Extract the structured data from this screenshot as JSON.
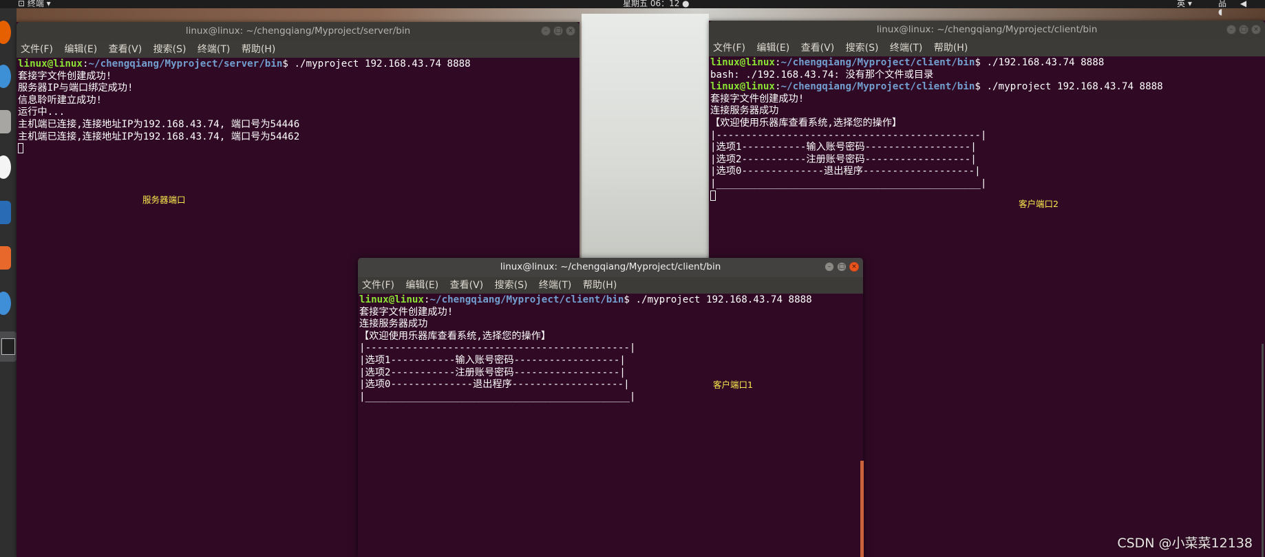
{
  "topbar": {
    "app_menu": "⊡ 终端 ▾",
    "clock": "星期五 06：12 ●",
    "ime": "英 ▾",
    "tray": "品 ◀ ◖"
  },
  "windows": {
    "server": {
      "title": "linux@linux: ~/chengqiang/Myproject/server/bin",
      "menu": [
        "文件(F)",
        "编辑(E)",
        "查看(V)",
        "搜索(S)",
        "终端(T)",
        "帮助(H)"
      ],
      "prompt": {
        "user": "linux@linux",
        "path": "~/chengqiang/Myproject/server/bin",
        "command": "$ ./myproject 192.168.43.74 8888"
      },
      "output": [
        "套接字文件创建成功!",
        "服务器IP与端口绑定成功!",
        "信息聆听建立成功!",
        "运行中...",
        "主机端已连接,连接地址IP为192.168.43.74, 端口号为54446",
        "主机端已连接,连接地址IP为192.168.43.74, 端口号为54462"
      ],
      "note": "服务器端口"
    },
    "client2": {
      "title": "linux@linux: ~/chengqiang/Myproject/client/bin",
      "menu": [
        "文件(F)",
        "编辑(E)",
        "查看(V)",
        "搜索(S)",
        "终端(T)",
        "帮助(H)"
      ],
      "prompt1": {
        "user": "linux@linux",
        "path": "~/chengqiang/Myproject/client/bin",
        "command": "$ ./192.168.43.74 8888"
      },
      "error": "bash: ./192.168.43.74: 没有那个文件或目录",
      "prompt2": {
        "user": "linux@linux",
        "path": "~/chengqiang/Myproject/client/bin",
        "command": "$ ./myproject 192.168.43.74 8888"
      },
      "output": [
        "套接字文件创建成功!",
        "连接服务器成功",
        "【欢迎使用乐器库查看系统,选择您的操作】",
        "|---------------------------------------------|",
        "|选项1-----------输入账号密码------------------|",
        "|选项2-----------注册账号密码------------------|",
        "|选项0--------------退出程序-------------------|",
        "|_____________________________________________|"
      ],
      "note": "客户端口2"
    },
    "client1": {
      "title": "linux@linux: ~/chengqiang/Myproject/client/bin",
      "menu": [
        "文件(F)",
        "编辑(E)",
        "查看(V)",
        "搜索(S)",
        "终端(T)",
        "帮助(H)"
      ],
      "prompt": {
        "user": "linux@linux",
        "path": "~/chengqiang/Myproject/client/bin",
        "command": "$ ./myproject 192.168.43.74 8888"
      },
      "output": [
        "套接字文件创建成功!",
        "连接服务器成功",
        "【欢迎使用乐器库查看系统,选择您的操作】",
        "|---------------------------------------------|",
        "|选项1-----------输入账号密码------------------|",
        "|选项2-----------注册账号密码------------------|",
        "|选项0--------------退出程序-------------------|",
        "|_____________________________________________|"
      ],
      "note": "客户端口1"
    }
  },
  "watermark": "CSDN @小菜菜12138",
  "colors": {
    "terminal_bg": "#300a24",
    "prompt_user": "#8ae234",
    "prompt_path": "#729fcf",
    "note_text": "#fce94f",
    "close_button": "#e9541f"
  }
}
